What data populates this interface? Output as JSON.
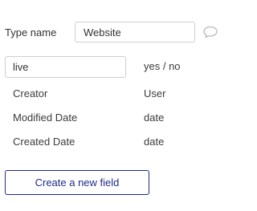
{
  "type": {
    "label": "Type name",
    "value": "Website"
  },
  "comment_icon": "comment-bubble-icon",
  "new_field": {
    "value": "live",
    "type": "yes / no"
  },
  "fields": [
    {
      "name": "Creator",
      "type": "User"
    },
    {
      "name": "Modified Date",
      "type": "date"
    },
    {
      "name": "Created Date",
      "type": "date"
    }
  ],
  "create_button": {
    "label": "Create a new field"
  },
  "colors": {
    "accent": "#1e2a8c",
    "border": "#cfcfcf",
    "text": "#3b3b3b"
  }
}
